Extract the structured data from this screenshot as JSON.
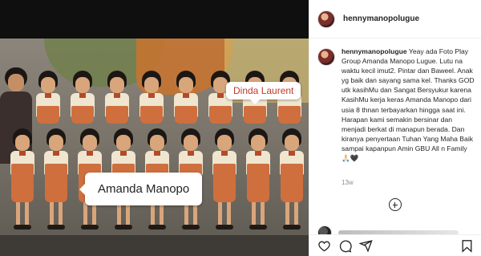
{
  "post": {
    "username": "hennymanopolugue",
    "caption": {
      "username": "hennymanopolugue",
      "text": "Yeay ada Foto Play Group Amanda Manopo Lugue. Lutu na waktu kecil imut2. Pintar dan Baweel. Anak yg baik dan sayang sama kel. Thanks GOD utk kasihMu dan Sangat Bersyukur karena KasihMu kerja keras Amanda Manopo dari usia 8 thnan terbayarkan hingga saat ini. Harapan kami semakin bersinar dan menjadi berkat di manapun berada. Dan kiranya penyertaan Tuhan Yang Maha Baik sampai kapanpun Amin GBU All n Family 🙏🏻🖤"
    },
    "timestamp": "13w"
  },
  "photo": {
    "labels": {
      "dinda": "Dinda Laurent",
      "amanda": "Amanda Manopo"
    }
  },
  "icons": {
    "load_more": "plus-circle-icon",
    "like": "heart-icon",
    "comment": "comment-icon",
    "share": "paper-plane-icon",
    "save": "bookmark-icon"
  },
  "colors": {
    "text": "#262626",
    "muted": "#8e8e8e",
    "dinda_label": "#c0392b"
  }
}
